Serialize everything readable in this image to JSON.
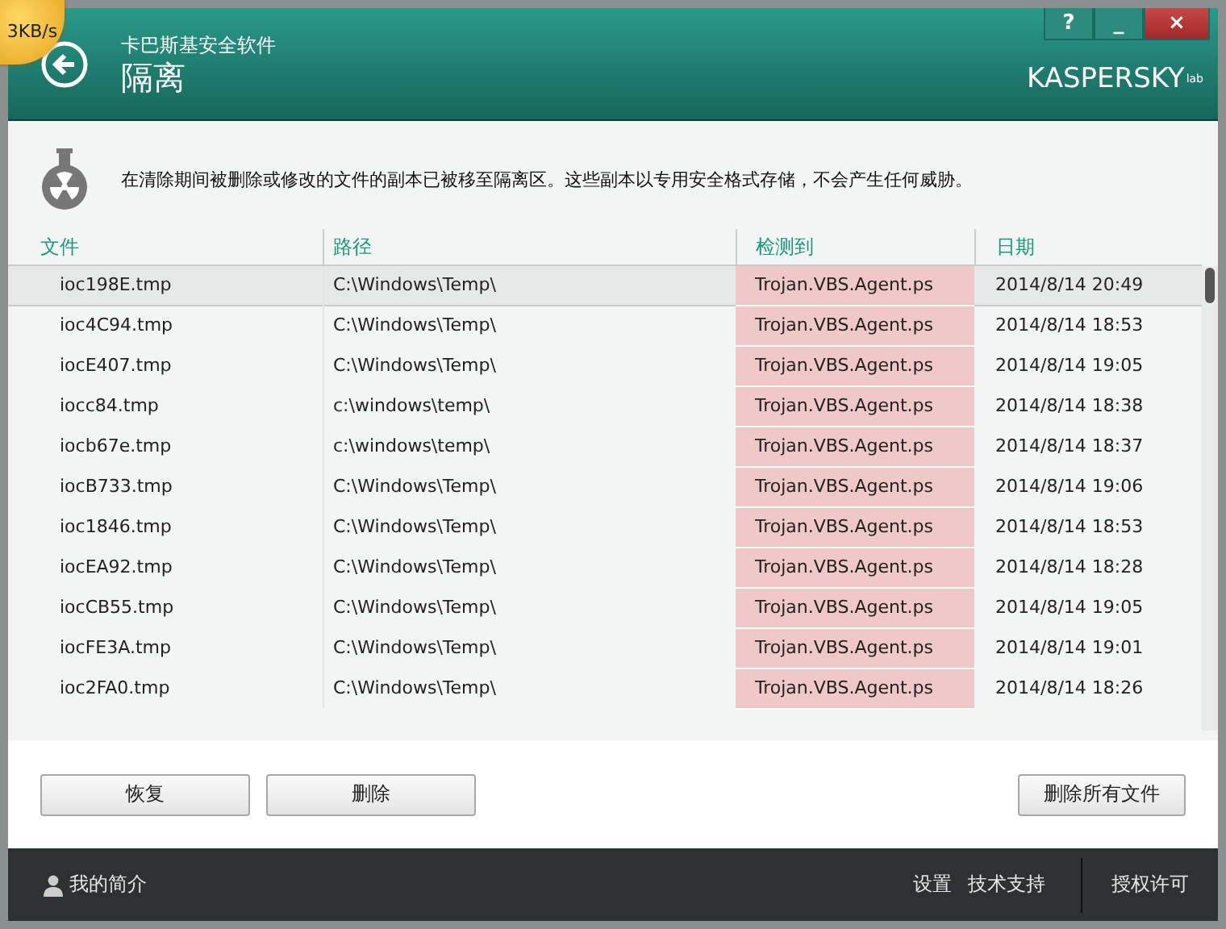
{
  "speed_badge": "3KB/s",
  "header": {
    "app_name": "卡巴斯基安全软件",
    "title": "隔离",
    "logo": "KASPERSKY",
    "logo_suffix": "lab",
    "help": "?",
    "minimize": "_",
    "close": "×"
  },
  "notice": "在清除期间被删除或修改的文件的副本已被移至隔离区。这些副本以专用安全格式存储，不会产生任何威胁。",
  "table": {
    "columns": [
      "文件",
      "路径",
      "检测到",
      "日期"
    ],
    "rows": [
      {
        "cells": [
          "ioc198E.tmp",
          "C:\\Windows\\Temp\\",
          "Trojan.VBS.Agent.ps",
          "2014/8/14 20:49"
        ],
        "selected": true
      },
      {
        "cells": [
          "ioc4C94.tmp",
          "C:\\Windows\\Temp\\",
          "Trojan.VBS.Agent.ps",
          "2014/8/14 18:53"
        ],
        "selected": false
      },
      {
        "cells": [
          "iocE407.tmp",
          "C:\\Windows\\Temp\\",
          "Trojan.VBS.Agent.ps",
          "2014/8/14 19:05"
        ],
        "selected": false
      },
      {
        "cells": [
          "iocc84.tmp",
          "c:\\windows\\temp\\",
          "Trojan.VBS.Agent.ps",
          "2014/8/14 18:38"
        ],
        "selected": false
      },
      {
        "cells": [
          "iocb67e.tmp",
          "c:\\windows\\temp\\",
          "Trojan.VBS.Agent.ps",
          "2014/8/14 18:37"
        ],
        "selected": false
      },
      {
        "cells": [
          "iocB733.tmp",
          "C:\\Windows\\Temp\\",
          "Trojan.VBS.Agent.ps",
          "2014/8/14 19:06"
        ],
        "selected": false
      },
      {
        "cells": [
          "ioc1846.tmp",
          "C:\\Windows\\Temp\\",
          "Trojan.VBS.Agent.ps",
          "2014/8/14 18:53"
        ],
        "selected": false
      },
      {
        "cells": [
          "iocEA92.tmp",
          "C:\\Windows\\Temp\\",
          "Trojan.VBS.Agent.ps",
          "2014/8/14 18:28"
        ],
        "selected": false
      },
      {
        "cells": [
          "iocCB55.tmp",
          "C:\\Windows\\Temp\\",
          "Trojan.VBS.Agent.ps",
          "2014/8/14 19:05"
        ],
        "selected": false
      },
      {
        "cells": [
          "iocFE3A.tmp",
          "C:\\Windows\\Temp\\",
          "Trojan.VBS.Agent.ps",
          "2014/8/14 19:01"
        ],
        "selected": false
      },
      {
        "cells": [
          "ioc2FA0.tmp",
          "C:\\Windows\\Temp\\",
          "Trojan.VBS.Agent.ps",
          "2014/8/14 18:26"
        ],
        "selected": false
      }
    ]
  },
  "buttons": {
    "left": [
      "恢复",
      "删除"
    ],
    "right": [
      "删除所有文件"
    ]
  },
  "footer": {
    "profile": "我的简介",
    "links": [
      "设置",
      "技术支持"
    ],
    "license": "授权许可"
  }
}
